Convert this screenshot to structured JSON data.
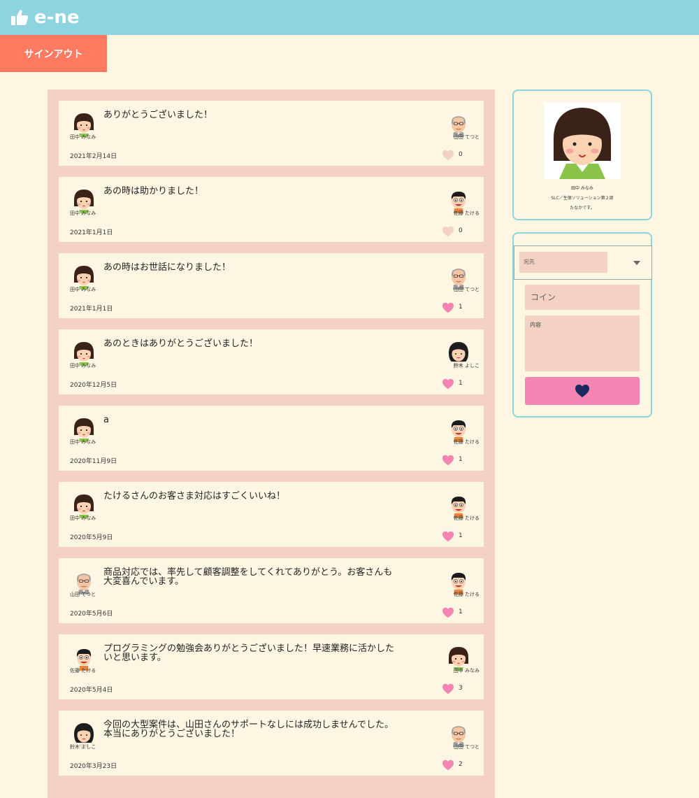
{
  "app": {
    "title": "e-ne",
    "logo_icon": "thumbs-up-icon",
    "colors": {
      "header": "#8dd4df",
      "accent": "#ff7a60",
      "like_active": "#f485b2",
      "like_inactive": "#f3d2c3",
      "panel": "#f3d2c3",
      "background": "#fdf6e3"
    }
  },
  "header": {
    "signout_label": "サインアウト"
  },
  "feed": [
    {
      "from": "田中 みなみ",
      "from_avatar": "girl",
      "to": "山田 てつと",
      "to_avatar": "oldman",
      "message": "ありがとうございました！",
      "date": "2021年2月14日",
      "likes": "0",
      "liked": false
    },
    {
      "from": "田中 みなみ",
      "from_avatar": "girl",
      "to": "佐藤 たける",
      "to_avatar": "boy",
      "message": "あの時は助かりました！",
      "date": "2021年1月1日",
      "likes": "0",
      "liked": false
    },
    {
      "from": "田中 みなみ",
      "from_avatar": "girl",
      "to": "山田 てつと",
      "to_avatar": "oldman",
      "message": "あの時はお世話になりました！",
      "date": "2021年1月1日",
      "likes": "1",
      "liked": true
    },
    {
      "from": "田中 みなみ",
      "from_avatar": "girl",
      "to": "鈴木 よしこ",
      "to_avatar": "woman",
      "message": "あのときはありがとうございました！",
      "date": "2020年12月5日",
      "likes": "1",
      "liked": true
    },
    {
      "from": "田中 みなみ",
      "from_avatar": "girl",
      "to": "佐藤 たける",
      "to_avatar": "boy",
      "message": "a",
      "date": "2020年11月9日",
      "likes": "1",
      "liked": true
    },
    {
      "from": "田中 みなみ",
      "from_avatar": "girl",
      "to": "佐藤 たける",
      "to_avatar": "boy",
      "message": "たけるさんのお客さま対応はすごくいいね！",
      "date": "2020年5月9日",
      "likes": "1",
      "liked": true
    },
    {
      "from": "山田 てつと",
      "from_avatar": "oldman",
      "to": "佐藤 たける",
      "to_avatar": "boy",
      "message": "商品対応では、率先して顧客調整をしてくれてありがとう。お客さんも大変喜んでいます。",
      "date": "2020年5月6日",
      "likes": "1",
      "liked": true
    },
    {
      "from": "佐藤 たける",
      "from_avatar": "boy",
      "to": "田中 みなみ",
      "to_avatar": "girl",
      "message": "プログラミングの勉強会ありがとうございました！早速業務に活かしたいと思います。",
      "date": "2020年5月4日",
      "likes": "3",
      "liked": true
    },
    {
      "from": "鈴木 よしこ",
      "from_avatar": "woman",
      "to": "山田 てつと",
      "to_avatar": "oldman",
      "message": "今回の大型案件は、山田さんのサポートなしには成功しませんでした。本当にありがとうございました！",
      "date": "2020年3月23日",
      "likes": "2",
      "liked": true
    }
  ],
  "profile": {
    "name": "田中 みなみ",
    "department": "SLC／生保ソリューション第２部",
    "bio": "たなかです。",
    "photo": "girl"
  },
  "send_form": {
    "recipient_placeholder": "宛先",
    "coin_placeholder": "コイン",
    "content_placeholder": "内容",
    "send_icon": "heart-icon"
  }
}
